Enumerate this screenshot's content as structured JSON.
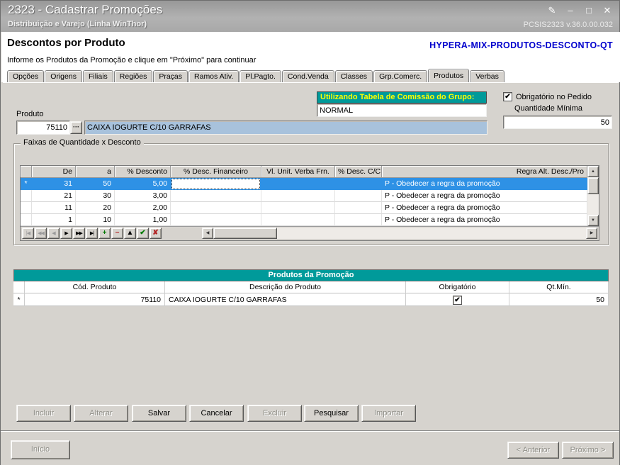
{
  "icons": {
    "edit": "✎",
    "minimize": "–",
    "maximize": "□",
    "close": "✕",
    "lookup": "···",
    "check": "✔",
    "up": "▲",
    "down": "▼",
    "left": "◀",
    "right": "▶"
  },
  "window": {
    "title": "2323 - Cadastrar Promoções",
    "subtitle": "Distribuição e Varejo (Linha WinThor)",
    "version": "PCSIS2323  v.36.0.00.032"
  },
  "header": {
    "title": "Descontos por Produto",
    "instruction": "Informe os Produtos da Promoção e clique em \"Próximo\" para continuar",
    "promo_code": "HYPERA-MIX-PRODUTOS-DESCONTO-QT"
  },
  "tabs": {
    "items": [
      "Opções",
      "Origens",
      "Filiais",
      "Regiões",
      "Praças",
      "Ramos Ativ.",
      "Pl.Pagto.",
      "Cond.Venda",
      "Classes",
      "Grp.Comerc.",
      "Produtos",
      "Verbas"
    ],
    "active_index": 10
  },
  "main": {
    "commission_banner": "Utilizando Tabela de Comissão do Grupo:",
    "commission_value": "NORMAL",
    "mandatory_checkbox_label": "Obrigatório no Pedido",
    "mandatory_checked": true,
    "min_qty_label": "Quantidade Mínima",
    "min_qty_value": "50",
    "product_label": "Produto",
    "product_code": "75110",
    "product_description": "CAIXA IOGURTE C/10 GARRAFAS"
  },
  "faixas": {
    "legend": "Faixas de Quantidade x Desconto",
    "columns": [
      "De",
      "a",
      "% Desconto",
      "% Desc. Financeiro",
      "Vl. Unit. Verba Frn.",
      "% Desc. C/C",
      "Regra Alt. Desc./Pro"
    ],
    "rows": [
      {
        "indicator": "*",
        "de": "31",
        "a": "50",
        "desconto": "5,00",
        "desc_fin": "",
        "vl_unit": "",
        "desc_cc": "",
        "regra": "P - Obedecer a regra da promoção",
        "selected": true
      },
      {
        "indicator": "",
        "de": "21",
        "a": "30",
        "desconto": "3,00",
        "desc_fin": "",
        "vl_unit": "",
        "desc_cc": "",
        "regra": "P - Obedecer a regra da promoção",
        "selected": false
      },
      {
        "indicator": "",
        "de": "11",
        "a": "20",
        "desconto": "2,00",
        "desc_fin": "",
        "vl_unit": "",
        "desc_cc": "",
        "regra": "P - Obedecer a regra da promoção",
        "selected": false
      },
      {
        "indicator": "",
        "de": "1",
        "a": "10",
        "desconto": "1,00",
        "desc_fin": "",
        "vl_unit": "",
        "desc_cc": "",
        "regra": "P - Obedecer a regra da promoção",
        "selected": false
      }
    ],
    "nav": [
      {
        "name": "first",
        "glyph": "|◀",
        "enabled": false
      },
      {
        "name": "prior-page",
        "glyph": "◀◀",
        "enabled": false
      },
      {
        "name": "prior",
        "glyph": "◀",
        "enabled": false
      },
      {
        "name": "next",
        "glyph": "▶",
        "enabled": true
      },
      {
        "name": "next-page",
        "glyph": "▶▶",
        "enabled": true
      },
      {
        "name": "last",
        "glyph": "▶|",
        "enabled": true
      },
      {
        "name": "insert",
        "glyph": "+",
        "enabled": true
      },
      {
        "name": "delete",
        "glyph": "−",
        "enabled": true
      },
      {
        "name": "edit",
        "glyph": "▲",
        "enabled": true
      },
      {
        "name": "post",
        "glyph": "✔",
        "enabled": true
      },
      {
        "name": "cancel",
        "glyph": "✘",
        "enabled": true
      }
    ]
  },
  "produtos": {
    "title": "Produtos da Promoção",
    "columns": [
      "Cód. Produto",
      "Descrição do Produto",
      "Obrigatório",
      "Qt.Mín."
    ],
    "rows": [
      {
        "indicator": "*",
        "cod": "75110",
        "desc": "CAIXA IOGURTE C/10 GARRAFAS",
        "obrigatorio": true,
        "qtmin": "50"
      }
    ]
  },
  "actions": [
    {
      "label": "Incluir",
      "enabled": false
    },
    {
      "label": "Alterar",
      "enabled": false
    },
    {
      "label": "Salvar",
      "enabled": true
    },
    {
      "label": "Cancelar",
      "enabled": true
    },
    {
      "label": "Excluir",
      "enabled": false
    },
    {
      "label": "Pesquisar",
      "enabled": true
    },
    {
      "label": "Importar",
      "enabled": false
    }
  ],
  "footer": {
    "inicio": {
      "label": "Início",
      "enabled": false
    },
    "anterior": {
      "label": "< Anterior",
      "enabled": false
    },
    "proximo": {
      "label": "Próximo >",
      "enabled": false
    }
  },
  "colors": {
    "teal": "#009a9a",
    "banner_text": "#ffff00",
    "selection_blue": "#2e91e5",
    "promo_code_blue": "#0000cd",
    "field_highlight": "#a8c2dc"
  }
}
